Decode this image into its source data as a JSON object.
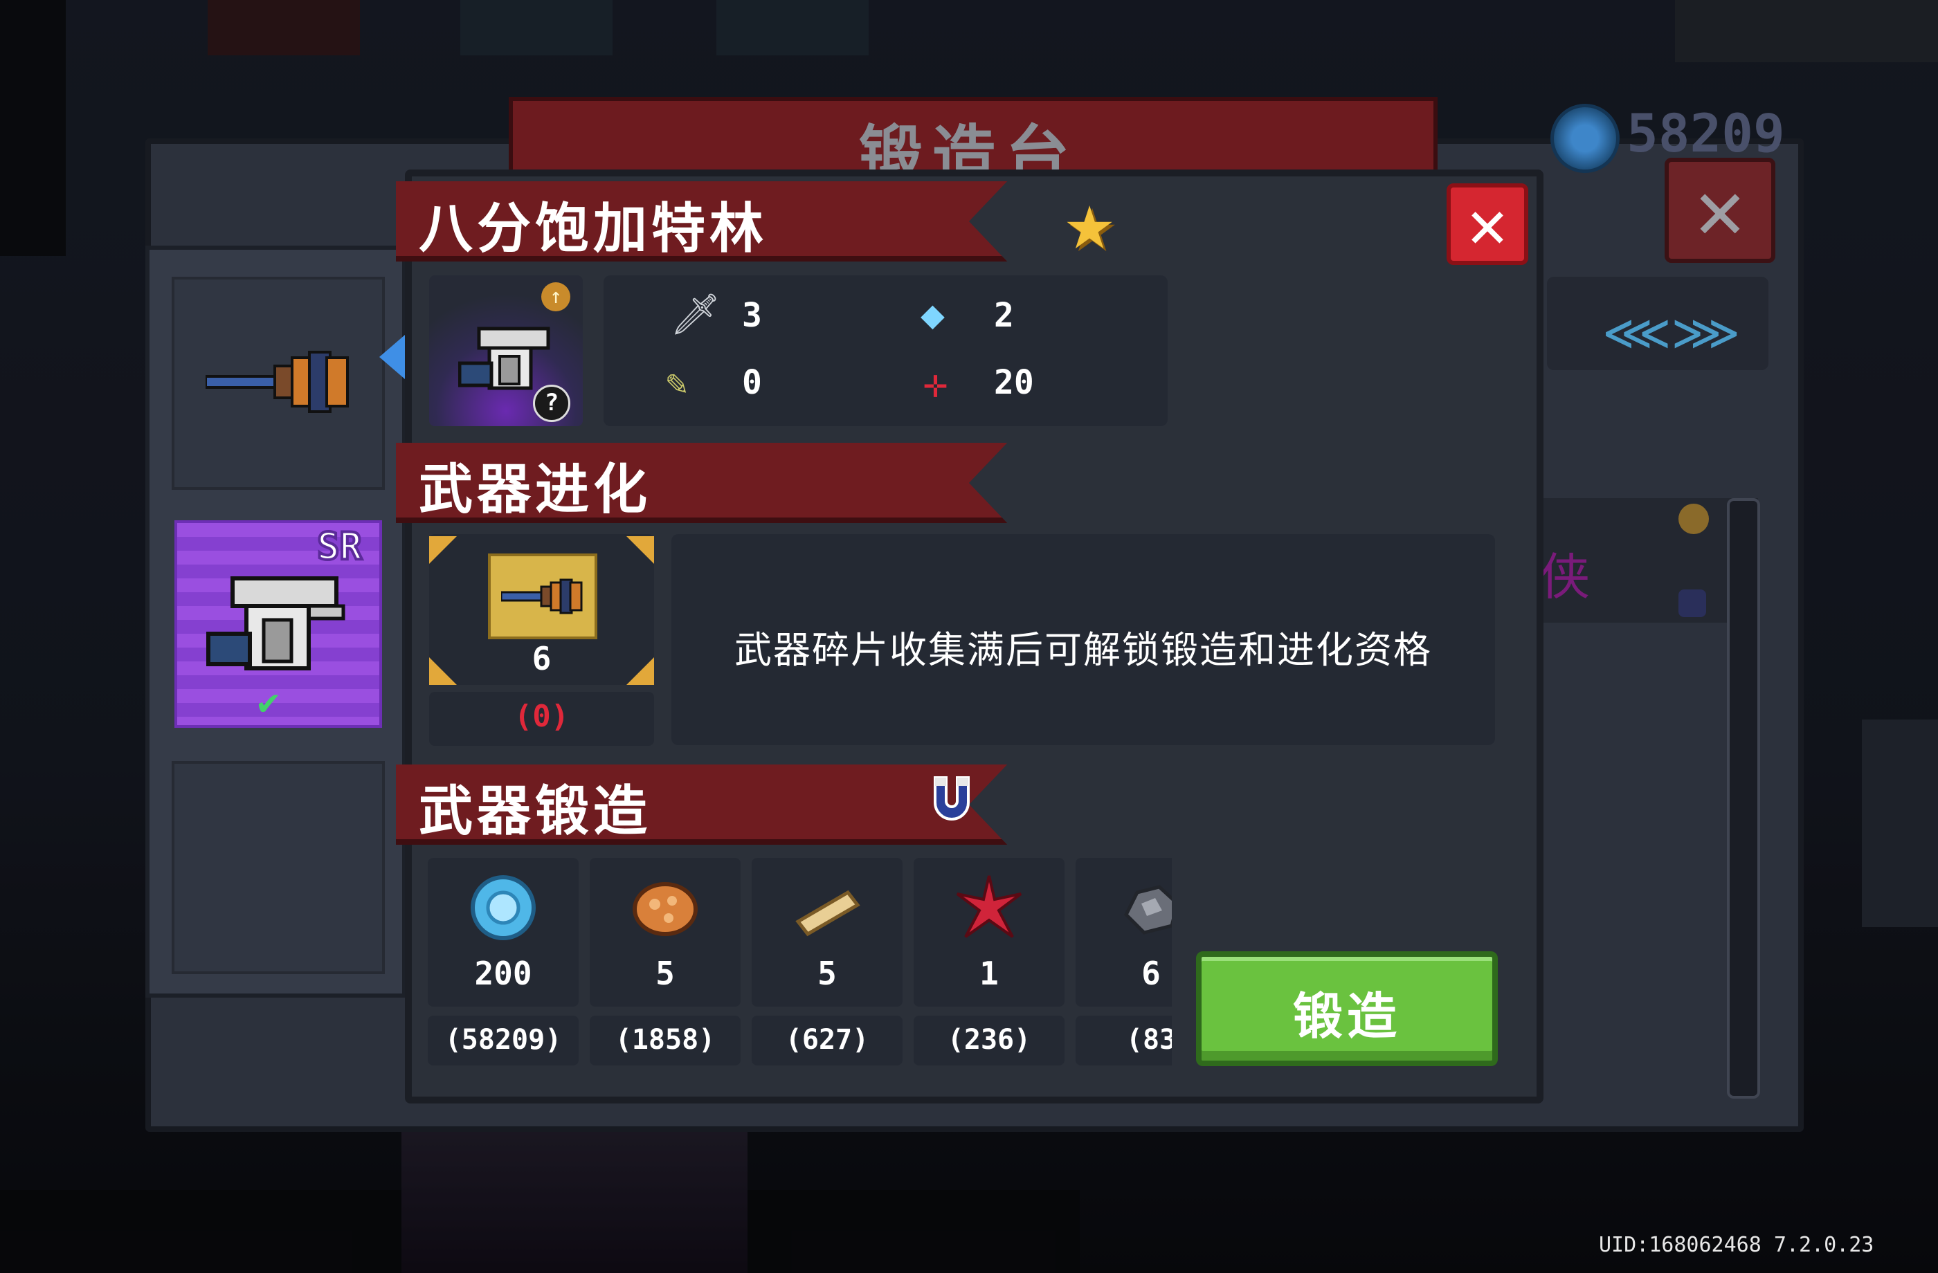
{
  "background": {
    "title": "锻造台",
    "coins": "58209",
    "list_item_text": "侠"
  },
  "weapon": {
    "name": "八分饱加特林",
    "rarity": "SR",
    "stats": {
      "attack": "3",
      "energy": "2",
      "crit": "0",
      "spread": "20"
    }
  },
  "evolution": {
    "section_title": "武器进化",
    "fragment_required": "6",
    "fragment_owned": "(0)",
    "description": "武器碎片收集满后可解锁锻造和进化资格"
  },
  "forge": {
    "section_title": "武器锻造",
    "button_label": "锻造",
    "materials": [
      {
        "icon": "gem-icon",
        "need": "200",
        "have": "(58209)"
      },
      {
        "icon": "ore-icon",
        "need": "5",
        "have": "(1858)"
      },
      {
        "icon": "wood-icon",
        "need": "5",
        "have": "(627)"
      },
      {
        "icon": "red-leaf-icon",
        "need": "1",
        "have": "(236)"
      },
      {
        "icon": "iron-ore-icon",
        "need": "6",
        "have": "(83"
      }
    ]
  },
  "footer": {
    "uid": "UID:168062468 7.2.0.23"
  },
  "colors": {
    "banner": "#6f1c20",
    "close": "#d52630",
    "forge_button": "#6ac23f",
    "sr_purple": "#9a4fe0",
    "missing_red": "#e0283a"
  }
}
